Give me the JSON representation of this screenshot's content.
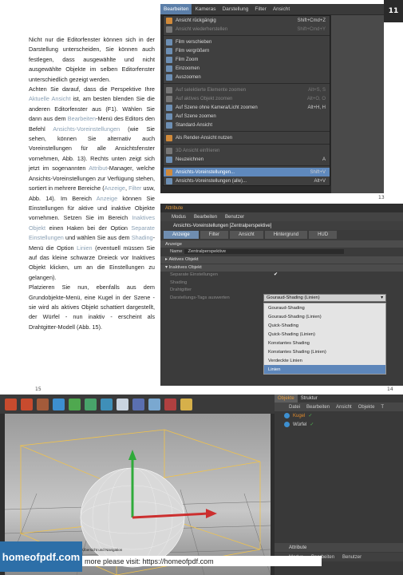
{
  "page_number": "11",
  "body_paragraphs": [
    {
      "segments": [
        {
          "t": "Nicht nur die Editorfenster können sich in der Darstellung unterscheiden, Sie können auch festlegen, dass ausgewählte und nicht ausgewählte Objekte im selben Editorfenster unterschiedlich gezeigt werden.",
          "hl": false
        }
      ]
    },
    {
      "segments": [
        {
          "t": "Achten Sie darauf, dass die Perspektive Ihre ",
          "hl": false
        },
        {
          "t": "Aktuelle Ansicht",
          "hl": true
        },
        {
          "t": " ist, am besten blenden Sie die anderen Editorfenster aus (F1). Wählen Sie dann aus dem ",
          "hl": false
        },
        {
          "t": "Bearbeiten",
          "hl": true
        },
        {
          "t": "-Menü des Editors den Befehl ",
          "hl": false
        },
        {
          "t": "Ansichts-Voreinstellungen",
          "hl": true
        },
        {
          "t": " (wie Sie sehen, können Sie alternativ auch Voreinstellungen für alle Ansichtsfenster vornehmen, Abb. 13). Rechts unten zeigt sich jetzt im sogenannten ",
          "hl": false
        },
        {
          "t": "Attribut",
          "hl": true
        },
        {
          "t": "-Manager, welche Ansichts-Voreinstellungen zur Verfügung stehen, sortiert in mehrere Bereiche (",
          "hl": false
        },
        {
          "t": "Anzeige",
          "hl": true
        },
        {
          "t": ", ",
          "hl": false
        },
        {
          "t": "Filter",
          "hl": true
        },
        {
          "t": " usw, Abb. 14). Im Bereich ",
          "hl": false
        },
        {
          "t": "Anzeige",
          "hl": true
        },
        {
          "t": " können Sie Einstellungen für aktive und inaktive Objekte vornehmen. Setzen Sie im Bereich ",
          "hl": false
        },
        {
          "t": "Inaktives Objekt",
          "hl": true
        },
        {
          "t": " einen Haken bei der Option ",
          "hl": false
        },
        {
          "t": "Separate Einstellungen",
          "hl": true
        },
        {
          "t": " und wählen Sie aus dem ",
          "hl": false
        },
        {
          "t": "Shading",
          "hl": true
        },
        {
          "t": "-Menü die Option ",
          "hl": false
        },
        {
          "t": "Linien",
          "hl": true
        },
        {
          "t": " (eventuell müssen Sie auf das kleine schwarze Dreieck vor Inaktives Objekt klicken, um an die Einstellungen zu gelangen).",
          "hl": false
        }
      ]
    },
    {
      "segments": [
        {
          "t": "Platzieren Sie nun, ebenfalls aus dem Grundobjekte-Menü, eine Kugel in der Szene - sie wird als aktives Objekt schattiert dargestellt, der Würfel - nun inaktiv - erscheint als Drahtgitter-Modell (Abb. 15).",
          "hl": false
        }
      ]
    }
  ],
  "fig13": {
    "caption": "13",
    "menubar": [
      "Bearbeiten",
      "Kameras",
      "Darstellung",
      "Filter",
      "Ansicht"
    ],
    "items": [
      {
        "label": "Ansicht rückgängig",
        "shortcut": "Shift+Cmd+Z",
        "dim": false,
        "icon": "o"
      },
      {
        "label": "Ansicht wiederherstellen",
        "shortcut": "Shift+Cmd+Y",
        "dim": true,
        "icon": "g"
      },
      {
        "sep": true
      },
      {
        "label": "Film verschieben",
        "shortcut": "",
        "dim": false,
        "icon": "b"
      },
      {
        "label": "Film vergrößern",
        "shortcut": "",
        "dim": false,
        "icon": "b"
      },
      {
        "label": "Film Zoom",
        "shortcut": "",
        "dim": false,
        "icon": "b"
      },
      {
        "label": "Einzoomen",
        "shortcut": "",
        "dim": false,
        "icon": "b"
      },
      {
        "label": "Auszoomen",
        "shortcut": "",
        "dim": false,
        "icon": "b"
      },
      {
        "sep": true
      },
      {
        "label": "Auf selektierte Elemente zoomen",
        "shortcut": "Alt+S, S",
        "dim": true,
        "icon": "g"
      },
      {
        "label": "Auf aktives Objekt zoomen",
        "shortcut": "Alt+O, O",
        "dim": true,
        "icon": "g"
      },
      {
        "label": "Auf Szene ohne Kamera/Licht zoomen",
        "shortcut": "Alt+H, H",
        "dim": false,
        "icon": "b"
      },
      {
        "label": "Auf Szene zoomen",
        "shortcut": "",
        "dim": false,
        "icon": "b"
      },
      {
        "label": "Standard-Ansicht",
        "shortcut": "",
        "dim": false,
        "icon": "b"
      },
      {
        "sep": true
      },
      {
        "label": "Als Render-Ansicht nutzen",
        "shortcut": "",
        "dim": false,
        "icon": "o"
      },
      {
        "sep": true
      },
      {
        "label": "3D Ansicht einfrieren",
        "shortcut": "",
        "dim": true,
        "icon": "g"
      },
      {
        "label": "Neuzeichnen",
        "shortcut": "A",
        "dim": false,
        "icon": "b"
      },
      {
        "sep": true
      },
      {
        "label": "Ansichts-Voreinstellungen...",
        "shortcut": "Shift+V",
        "dim": false,
        "icon": "o",
        "sel": true
      },
      {
        "label": "Ansichts-Voreinstellungen (alle)...",
        "shortcut": "Alt+V",
        "dim": false,
        "icon": "b"
      }
    ]
  },
  "fig14": {
    "caption": "14",
    "title": "Attribute",
    "menu": [
      "Modus",
      "Bearbeiten",
      "Benutzer"
    ],
    "subtitle": "Ansichts-Voreinstellungen [Zentralperspektive]",
    "tabs": [
      "Anzeige",
      "Filter",
      "Ansicht",
      "Hintergrund",
      "HUD"
    ],
    "section": "Anzeige",
    "name_label": "Name",
    "name_value": "Zentralperspektive",
    "groups": [
      "Aktives Objekt",
      "Inaktives Objekt"
    ],
    "rows": [
      "Separate Einstellungen",
      "Shading",
      "Drahtgitter",
      "Darstellungs-Tags auswerten"
    ],
    "selected_value": "Gouraud-Shading (Linien)",
    "options": [
      "Gouraud-Shading",
      "Gouraud-Shading (Linien)",
      "Quick-Shading",
      "Quick-Shading (Linien)",
      "Konstantes Shading",
      "Konstantes Shading (Linien)",
      "Verdeckte Linien",
      "Linien"
    ],
    "checkmark": "✔"
  },
  "fig15": {
    "caption": "15",
    "obj_tabs": [
      "Objekte",
      "Struktur"
    ],
    "obj_menu": [
      "Datei",
      "Bearbeiten",
      "Ansicht",
      "Objekte",
      "T"
    ],
    "objects": [
      {
        "name": "Kugel",
        "color": "#e08a2c"
      },
      {
        "name": "Würfel",
        "color": "#d7d7d7"
      }
    ],
    "attr_title": "Attribute",
    "attr_menu": [
      "Modus",
      "Bearbeiten",
      "Benutzer"
    ],
    "overlay_text": "Übersicht und Navigation"
  },
  "footer": {
    "logo": "homeofpdf.com",
    "more": "more please visit: https://homeofpdf.com"
  },
  "colors": {
    "highlight": "#8aa0b4",
    "menu_active": "#5b7ea8",
    "logo_bg": "#2d6fa8"
  }
}
